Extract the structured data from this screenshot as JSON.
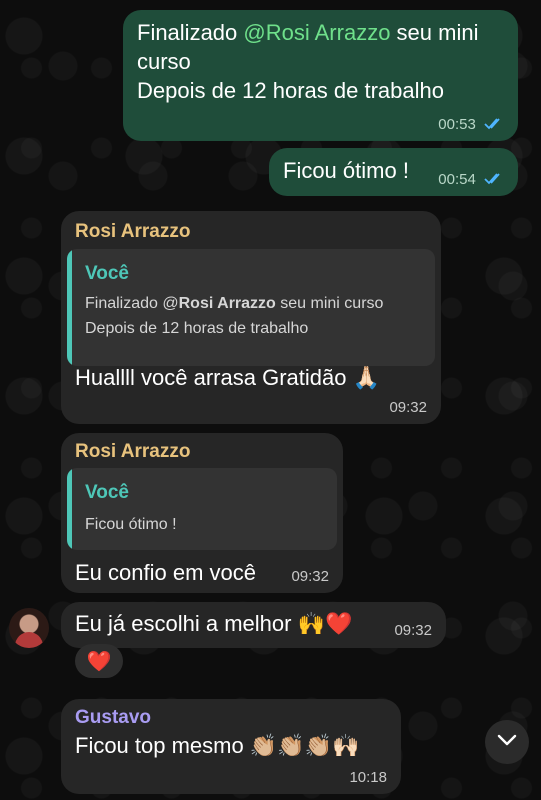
{
  "messages": {
    "m1": {
      "prefix": "Finalizado ",
      "mention": "@Rosi Arrazzo",
      "suffix": " seu mini",
      "line2": "curso",
      "line3": "Depois de 12 horas de trabalho",
      "time": "00:53",
      "status": "read"
    },
    "m2": {
      "text": "Ficou ótimo !",
      "time": "00:54",
      "status": "read"
    },
    "m3": {
      "sender": "Rosi Arrazzo",
      "quote_name": "Você",
      "quote_line1_prefix": "Finalizado @",
      "quote_line1_mention": "Rosi Arrazzo",
      "quote_line1_suffix": " seu mini curso",
      "quote_line2": "Depois de 12 horas de trabalho",
      "text": "Huallll você arrasa Gratidão",
      "emoji": "🙏🏻",
      "time": "09:32"
    },
    "m4": {
      "sender": "Rosi Arrazzo",
      "quote_name": "Você",
      "quote_text": "Ficou ótimo !",
      "text": "Eu confio em você",
      "time": "09:32"
    },
    "m5": {
      "text": "Eu já escolhi a melhor",
      "emoji": "🙌❤️",
      "time": "09:32",
      "reaction": "❤️"
    },
    "m6": {
      "sender": "Gustavo",
      "text": "Ficou top mesmo",
      "emoji": "👏🏼👏🏼👏🏼🙌🏻",
      "time": "10:18"
    }
  },
  "icons": {
    "read_ticks": "double-check-icon",
    "scroll_down": "chevron-down-icon",
    "avatar": "avatar"
  },
  "colors": {
    "outgoing_bubble": "#1f4d3a",
    "incoming_bubble": "#262626",
    "mention": "#6fe08b",
    "quote_accent": "#4ec7b8",
    "sender_rosi": "#e7c27d",
    "sender_gustavo": "#a99cf2",
    "read_tick": "#4fb5ff"
  }
}
